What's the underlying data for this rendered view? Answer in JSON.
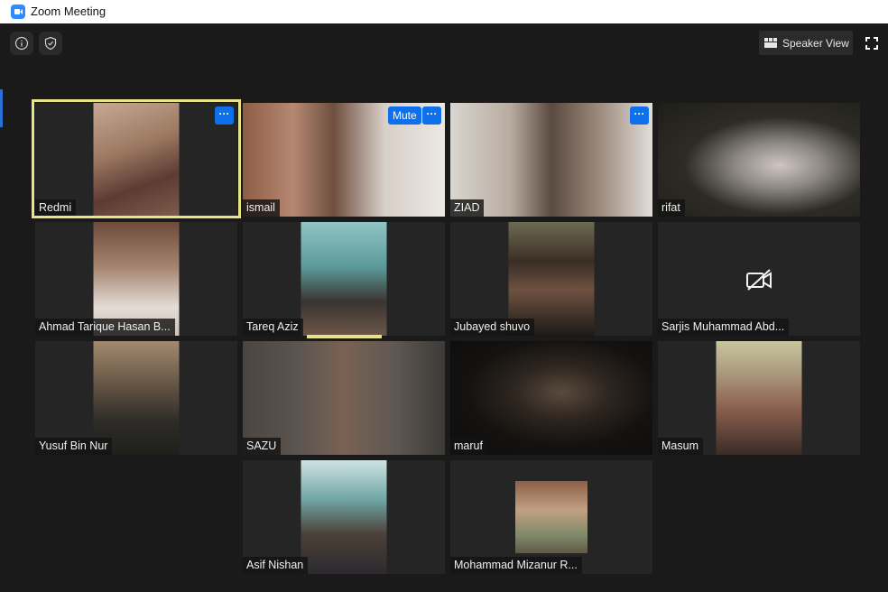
{
  "window": {
    "title": "Zoom Meeting"
  },
  "toolbar": {
    "speaker_view_label": "Speaker View"
  },
  "participants": [
    {
      "name": "Redmi",
      "video_bg": "#7b5a45",
      "active_speaker": true,
      "menu": "···"
    },
    {
      "name": "ismail",
      "video_bg": "#8a6048",
      "mute": "Mute",
      "menu": "···"
    },
    {
      "name": "ZIAD",
      "video_bg": "#6f5c4d",
      "menu": "···"
    },
    {
      "name": "rifat",
      "video_bg": "#2c2a24"
    },
    {
      "name": "Ahmad Tarique Hasan B...",
      "video_bg": "#8e7563"
    },
    {
      "name": "Tareq Aziz",
      "video_bg": "#4c7a78"
    },
    {
      "name": "Jubayed shuvo",
      "video_bg": "#4a4235"
    },
    {
      "name": "Sarjis Muhammad Abd...",
      "camera_off": true
    },
    {
      "name": "Yusuf Bin Nur",
      "video_bg": "#4e4a40"
    },
    {
      "name": "SAZU",
      "video_bg": "#3c3a37"
    },
    {
      "name": "maruf",
      "video_bg": "#171411"
    },
    {
      "name": "Masum",
      "video_bg": "#8a6f5a"
    },
    {
      "name": "Asif Nishan",
      "video_bg": "#3f6c6a"
    },
    {
      "name": "Mohammad Mizanur R...",
      "video_bg": "#6d6253"
    }
  ]
}
